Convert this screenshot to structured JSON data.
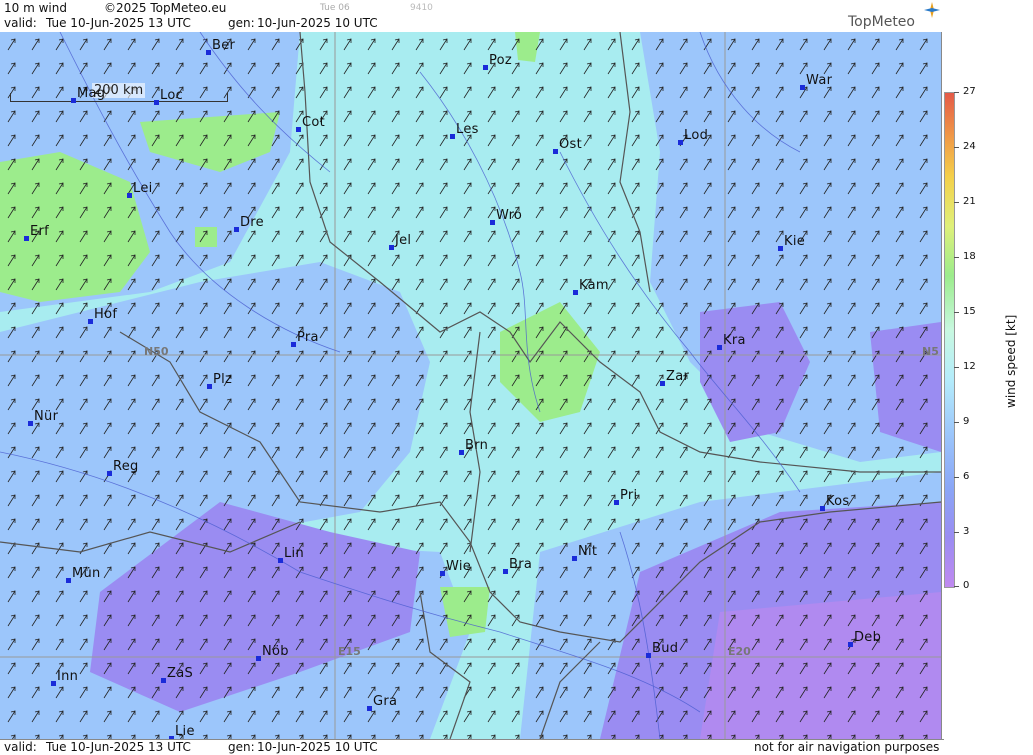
{
  "header": {
    "title": "10 m wind",
    "copyright": "©2025 TopMeteo.eu",
    "valid_label": "valid:",
    "valid_time": "Tue  10-Jun-2025  13 UTC",
    "gen_label": "gen:",
    "gen_time": "10-Jun-2025 10 UTC",
    "faint_day": "Tue 06",
    "faint_code": "9410",
    "logo": "TopMeteo"
  },
  "footer": {
    "valid_label": "valid:",
    "valid_time": "Tue  10-Jun-2025  13 UTC",
    "gen_label": "gen:",
    "gen_time": "10-Jun-2025 10 UTC",
    "disclaimer": "not for air navigation purposes"
  },
  "map": {
    "scale_label": "200 km",
    "gridlabels": {
      "n50": "N50",
      "n50_right": "N5",
      "e15": "E15",
      "e20": "E20"
    },
    "cities": [
      "Ber",
      "Poz",
      "War",
      "Mag",
      "Loc",
      "Cot",
      "Les",
      "Lod",
      "Ost",
      "Lei",
      "Erf",
      "Dre",
      "Wro",
      "Jel",
      "Kie",
      "Kam",
      "Hof",
      "Pra",
      "Kra",
      "Zar",
      "Plz",
      "Nür",
      "Brn",
      "Reg",
      "Pri",
      "Kos",
      "Lin",
      "Nit",
      "Wie",
      "Bra",
      "Mün",
      "Deb",
      "Nöb",
      "Bud",
      "Inn",
      "ZaS",
      "Gra",
      "Lie"
    ]
  },
  "legend": {
    "axis_label": "wind  speed  [kt]",
    "ticks": [
      "27",
      "24",
      "21",
      "18",
      "15",
      "12",
      "9",
      "6",
      "3",
      "0"
    ]
  },
  "colors": {
    "water_light": "#a8ecf0",
    "blue_zone": "#9cc6fb",
    "violet_zone": "#9a8cf2",
    "green_zone": "#9cec8c",
    "dot": "#1a2bd9"
  }
}
